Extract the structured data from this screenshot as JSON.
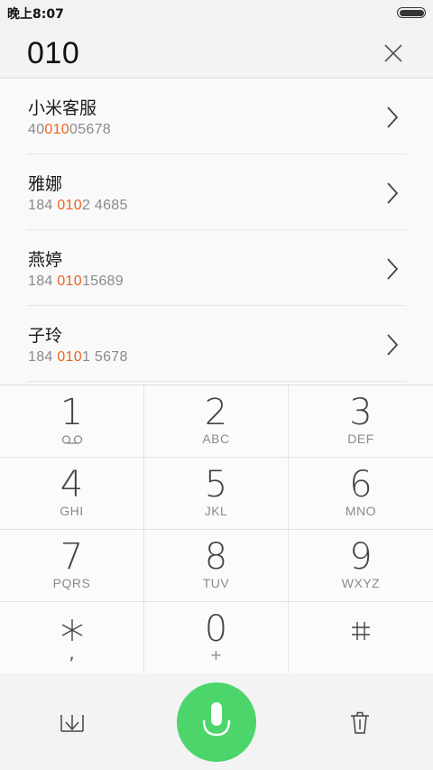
{
  "status": {
    "time": "晚上8:07"
  },
  "search": {
    "number": "010"
  },
  "contacts": [
    {
      "name": "小米客服",
      "num_pre": "40",
      "num_hl": "010",
      "num_post": "05678"
    },
    {
      "name": "雅娜",
      "num_pre": "184 ",
      "num_hl": "010",
      "num_post": "2 4685"
    },
    {
      "name": "燕婷",
      "num_pre": "184 ",
      "num_hl": "010",
      "num_post": "15689"
    },
    {
      "name": "子玲",
      "num_pre": "184 ",
      "num_hl": "010",
      "num_post": "1 5678"
    }
  ],
  "keypad": {
    "k1": {
      "digit": "1"
    },
    "k2": {
      "digit": "2",
      "letters": "ABC"
    },
    "k3": {
      "digit": "3",
      "letters": "DEF"
    },
    "k4": {
      "digit": "4",
      "letters": "GHI"
    },
    "k5": {
      "digit": "5",
      "letters": "JKL"
    },
    "k6": {
      "digit": "6",
      "letters": "MNO"
    },
    "k7": {
      "digit": "7",
      "letters": "PQRS"
    },
    "k8": {
      "digit": "8",
      "letters": "TUV"
    },
    "k9": {
      "digit": "9",
      "letters": "WXYZ"
    },
    "kstar": {
      "sub": ","
    },
    "k0": {
      "digit": "0",
      "sub": "+"
    },
    "khash": {}
  },
  "colors": {
    "highlight": "#f0631e",
    "mic_button": "#4cd56a"
  },
  "icons": {
    "clear": "close-icon",
    "row_arrow": "chevron-right-icon",
    "voicemail": "voicemail-icon",
    "collapse": "collapse-keypad-icon",
    "mic": "microphone-icon",
    "delete": "trash-icon"
  }
}
